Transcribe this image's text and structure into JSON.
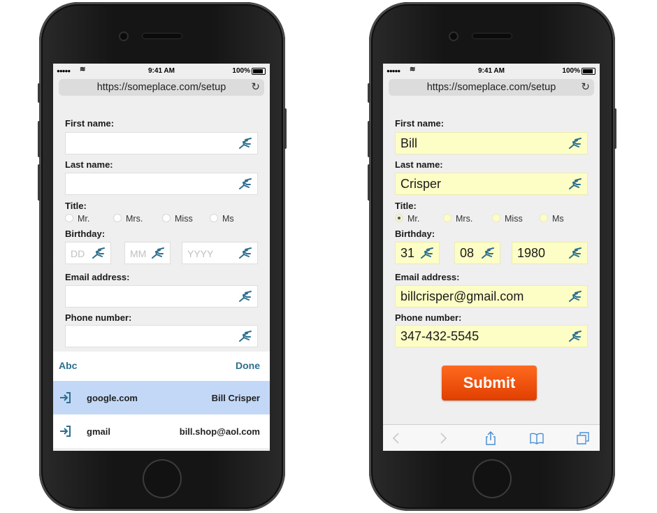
{
  "status": {
    "signal": "●●●●●",
    "time": "9:41 AM",
    "battery": "100%"
  },
  "url": "https://someplace.com/setup",
  "labels": {
    "first_name": "First name:",
    "last_name": "Last name:",
    "title": "Title:",
    "birthday": "Birthday:",
    "email": "Email address:",
    "phone": "Phone number:"
  },
  "title_options": [
    "Mr.",
    "Mrs.",
    "Miss",
    "Ms"
  ],
  "birthday_placeholders": {
    "day": "DD",
    "month": "MM",
    "year": "YYYY"
  },
  "left_phone": {
    "keyboard_bar": {
      "left": "Abc",
      "right": "Done"
    },
    "suggestions": [
      {
        "site": "google.com",
        "user": "Bill Crisper",
        "highlighted": true
      },
      {
        "site": "gmail",
        "user": "bill.shop@aol.com",
        "highlighted": false
      }
    ]
  },
  "right_phone": {
    "values": {
      "first_name": "Bill",
      "last_name": "Crisper",
      "title_selected": "Mr.",
      "birthday_day": "31",
      "birthday_month": "08",
      "birthday_year": "1980",
      "email": "billcrisper@gmail.com",
      "phone": "347-432-5545"
    },
    "submit_label": "Submit"
  },
  "colors": {
    "autofill_yellow": "#fdfdc6",
    "accent_teal": "#2d6f8e",
    "submit_orange": "#f05314",
    "suggestion_highlight": "#c3d8f7"
  },
  "icons": {
    "field_icon": "runner-icon",
    "toolbar": [
      "back-icon",
      "forward-icon",
      "share-icon",
      "bookmarks-icon",
      "tabs-icon"
    ]
  }
}
